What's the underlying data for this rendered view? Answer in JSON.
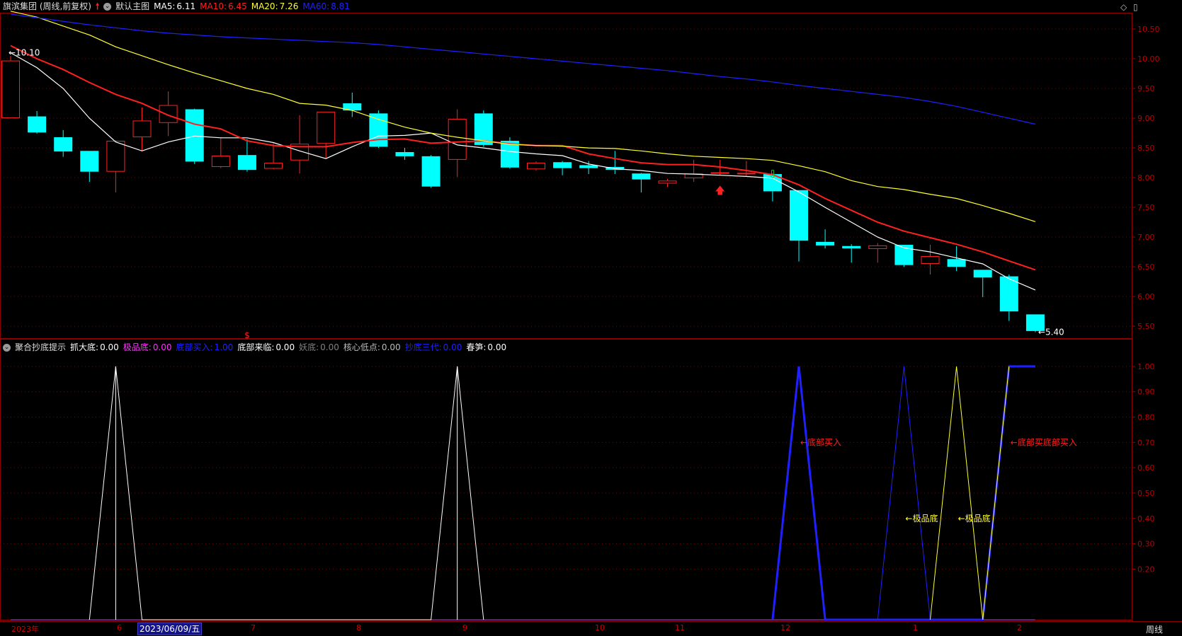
{
  "header_top": {
    "stock": "旗滨集团 (周线,前复权)",
    "theme": "默认主图",
    "ma": [
      {
        "label": "MA5:",
        "value": "6.11",
        "color": "#ffffff"
      },
      {
        "label": "MA10:",
        "value": "6.45",
        "color": "#ff2020"
      },
      {
        "label": "MA20:",
        "value": "7.26",
        "color": "#ffff30"
      },
      {
        "label": "MA60:",
        "value": "8.81",
        "color": "#2020ff"
      }
    ]
  },
  "header_bottom": {
    "indicator": "聚合抄底提示",
    "items": [
      {
        "label": "抓大底:",
        "value": "0.00",
        "color": "#ffffff"
      },
      {
        "label": "极品底:",
        "value": "0.00",
        "color": "#ff30ff"
      },
      {
        "label": "底部买入:",
        "value": "1.00",
        "color": "#2020ff"
      },
      {
        "label": "底部来临:",
        "value": "0.00",
        "color": "#ffffff"
      },
      {
        "label": "妖底:",
        "value": "0.00",
        "color": "#808080"
      },
      {
        "label": "核心低点:",
        "value": "0.00",
        "color": "#bbbbbb"
      },
      {
        "label": "抄底三代:",
        "value": "0.00",
        "color": "#2020ff"
      },
      {
        "label": "春笋:",
        "value": "0.00",
        "color": "#ffffff"
      }
    ]
  },
  "x_axis": {
    "labels": [
      "2023年",
      "6",
      "7",
      "8",
      "9",
      "10",
      "11",
      "12",
      "1",
      "2"
    ],
    "cursor_date": "2023/06/09/五",
    "period": "周线"
  },
  "chart_data": [
    {
      "type": "candlestick",
      "ylim": [
        5.3,
        10.75
      ],
      "y_ticks": [
        "10.50",
        "10.00",
        "9.50",
        "9.00",
        "8.50",
        "8.00",
        "7.50",
        "7.00",
        "6.50",
        "6.00",
        "5.50"
      ],
      "candles": [
        {
          "o": 9.0,
          "c": 9.97,
          "h": 10.05,
          "l": 9.0
        },
        {
          "o": 9.03,
          "c": 8.76,
          "h": 9.12,
          "l": 8.74
        },
        {
          "o": 8.68,
          "c": 8.44,
          "h": 8.8,
          "l": 8.35
        },
        {
          "o": 8.45,
          "c": 8.1,
          "h": 8.45,
          "l": 7.93
        },
        {
          "o": 8.1,
          "c": 8.62,
          "h": 8.63,
          "l": 7.75
        },
        {
          "o": 8.68,
          "c": 8.96,
          "h": 9.18,
          "l": 8.44
        },
        {
          "o": 8.92,
          "c": 9.22,
          "h": 9.45,
          "l": 8.7
        },
        {
          "o": 9.15,
          "c": 8.27,
          "h": 9.16,
          "l": 8.23
        },
        {
          "o": 8.18,
          "c": 8.37,
          "h": 8.67,
          "l": 8.16
        },
        {
          "o": 8.38,
          "c": 8.13,
          "h": 8.65,
          "l": 8.1
        },
        {
          "o": 8.15,
          "c": 8.25,
          "h": 8.58,
          "l": 8.14
        },
        {
          "o": 8.29,
          "c": 8.57,
          "h": 9.05,
          "l": 8.07
        },
        {
          "o": 8.57,
          "c": 9.11,
          "h": 9.11,
          "l": 8.32
        },
        {
          "o": 9.25,
          "c": 9.13,
          "h": 9.43,
          "l": 9.02
        },
        {
          "o": 9.08,
          "c": 8.52,
          "h": 9.13,
          "l": 8.5
        },
        {
          "o": 8.43,
          "c": 8.36,
          "h": 8.5,
          "l": 8.3
        },
        {
          "o": 8.36,
          "c": 7.85,
          "h": 8.38,
          "l": 7.83
        },
        {
          "o": 8.3,
          "c": 8.99,
          "h": 9.15,
          "l": 8.01
        },
        {
          "o": 9.08,
          "c": 8.55,
          "h": 9.13,
          "l": 8.52
        },
        {
          "o": 8.62,
          "c": 8.17,
          "h": 8.68,
          "l": 8.15
        },
        {
          "o": 8.14,
          "c": 8.25,
          "h": 8.27,
          "l": 8.12
        },
        {
          "o": 8.26,
          "c": 8.16,
          "h": 8.28,
          "l": 8.04
        },
        {
          "o": 8.21,
          "c": 8.16,
          "h": 8.28,
          "l": 8.06
        },
        {
          "o": 8.18,
          "c": 8.13,
          "h": 8.45,
          "l": 8.06
        },
        {
          "o": 8.07,
          "c": 7.97,
          "h": 8.08,
          "l": 7.75
        },
        {
          "o": 7.9,
          "c": 7.95,
          "h": 7.98,
          "l": 7.84
        },
        {
          "o": 7.99,
          "c": 8.07,
          "h": 8.3,
          "l": 7.93
        },
        {
          "o": 8.08,
          "c": 8.09,
          "h": 8.3,
          "l": 8.04
        },
        {
          "o": 8.08,
          "c": 8.08,
          "h": 8.28,
          "l": 8.03
        },
        {
          "o": 8.06,
          "c": 7.77,
          "h": 8.07,
          "l": 7.6
        },
        {
          "o": 7.79,
          "c": 6.94,
          "h": 7.79,
          "l": 6.59
        },
        {
          "o": 6.92,
          "c": 6.86,
          "h": 7.13,
          "l": 6.81
        },
        {
          "o": 6.85,
          "c": 6.81,
          "h": 6.88,
          "l": 6.57
        },
        {
          "o": 6.8,
          "c": 6.86,
          "h": 6.9,
          "l": 6.57
        },
        {
          "o": 6.87,
          "c": 6.53,
          "h": 6.87,
          "l": 6.5
        },
        {
          "o": 6.55,
          "c": 6.68,
          "h": 6.87,
          "l": 6.37
        },
        {
          "o": 6.63,
          "c": 6.5,
          "h": 6.85,
          "l": 6.43
        },
        {
          "o": 6.45,
          "c": 6.32,
          "h": 6.45,
          "l": 5.99
        },
        {
          "o": 6.34,
          "c": 5.75,
          "h": 6.37,
          "l": 5.59
        },
        {
          "o": 5.7,
          "c": 5.42,
          "h": 5.7,
          "l": 5.4
        }
      ],
      "series": [
        {
          "name": "MA5",
          "color": "#ffffff",
          "values": [
            10.1,
            9.85,
            9.5,
            9.0,
            8.6,
            8.45,
            8.6,
            8.7,
            8.67,
            8.67,
            8.59,
            8.45,
            8.32,
            8.52,
            8.7,
            8.71,
            8.75,
            8.55,
            8.5,
            8.44,
            8.4,
            8.37,
            8.23,
            8.15,
            8.12,
            8.07,
            8.06,
            8.04,
            8.02,
            7.99,
            7.76,
            7.5,
            7.25,
            7.0,
            6.82,
            6.75,
            6.65,
            6.55,
            6.3,
            6.11
          ]
        },
        {
          "name": "MA10",
          "color": "#ff2020",
          "values": [
            10.22,
            10.0,
            9.82,
            9.6,
            9.4,
            9.25,
            9.05,
            8.9,
            8.82,
            8.62,
            8.54,
            8.52,
            8.52,
            8.59,
            8.64,
            8.65,
            8.58,
            8.6,
            8.62,
            8.57,
            8.54,
            8.54,
            8.4,
            8.32,
            8.25,
            8.22,
            8.22,
            8.18,
            8.12,
            8.05,
            7.88,
            7.65,
            7.45,
            7.25,
            7.1,
            6.99,
            6.88,
            6.75,
            6.6,
            6.45
          ]
        },
        {
          "name": "MA20",
          "color": "#ffff30",
          "values": [
            10.8,
            10.7,
            10.55,
            10.4,
            10.2,
            10.05,
            9.9,
            9.76,
            9.63,
            9.5,
            9.4,
            9.25,
            9.22,
            9.13,
            8.98,
            8.85,
            8.75,
            8.68,
            8.62,
            8.56,
            8.54,
            8.53,
            8.5,
            8.49,
            8.45,
            8.4,
            8.36,
            8.34,
            8.32,
            8.29,
            8.2,
            8.1,
            7.95,
            7.85,
            7.8,
            7.72,
            7.65,
            7.53,
            7.4,
            7.26
          ]
        },
        {
          "name": "MA60",
          "color": "#2020ff",
          "values": [
            10.75,
            10.69,
            10.63,
            10.57,
            10.52,
            10.47,
            10.43,
            10.4,
            10.37,
            10.35,
            10.33,
            10.31,
            10.29,
            10.27,
            10.24,
            10.2,
            10.16,
            10.12,
            10.08,
            10.04,
            10.0,
            9.96,
            9.92,
            9.88,
            9.84,
            9.8,
            9.75,
            9.7,
            9.66,
            9.61,
            9.55,
            9.5,
            9.45,
            9.4,
            9.35,
            9.28,
            9.2,
            9.1,
            9.0,
            8.9
          ]
        }
      ],
      "annotations": [
        {
          "text": "←10.10",
          "index": 0,
          "value": 10.1
        },
        {
          "text": "←5.40",
          "index": 39,
          "value": 5.4
        }
      ],
      "markers": [
        {
          "type": "up-arrow",
          "index": 27,
          "color": "#ff2020"
        },
        {
          "type": "down-arrow",
          "index": 29,
          "color": "#30d030"
        },
        {
          "type": "dollar",
          "index": 9,
          "color": "#ff2020",
          "text": "$"
        }
      ]
    },
    {
      "type": "line",
      "ylim": [
        0,
        1.05
      ],
      "y_ticks": [
        "1.00",
        "0.90",
        "0.80",
        "0.70",
        "0.60",
        "0.50",
        "0.40",
        "0.30",
        "0.20"
      ],
      "series": [
        {
          "name": "抓大底",
          "color": "#ffffff",
          "width": 1,
          "points": [
            [
              3,
              0
            ],
            [
              4,
              1
            ],
            [
              5,
              0
            ],
            [
              16,
              0
            ],
            [
              17,
              1
            ],
            [
              18,
              0
            ]
          ]
        },
        {
          "name": "底部买入",
          "color": "#2020ff",
          "width": 3,
          "points": [
            [
              29,
              0
            ],
            [
              30,
              1
            ],
            [
              31,
              0
            ],
            [
              37,
              0
            ],
            [
              38,
              1
            ],
            [
              39,
              1
            ]
          ]
        },
        {
          "name": "抄底三代",
          "color": "#2020ff",
          "width": 1,
          "points": [
            [
              33,
              0
            ],
            [
              34,
              1
            ],
            [
              35,
              0
            ]
          ]
        },
        {
          "name": "极品底",
          "color": "#ffff30",
          "width": 1,
          "points": [
            [
              35,
              0
            ],
            [
              36,
              1
            ],
            [
              37,
              0
            ]
          ]
        },
        {
          "name": "妖底",
          "color": "#ffff30",
          "width": 1,
          "points": [
            [
              37,
              0
            ],
            [
              38,
              1
            ]
          ]
        }
      ],
      "annotations": [
        {
          "text": "←底部买入",
          "color": "#ff2020",
          "index": 30,
          "value": 0.7
        },
        {
          "text": "←底部买底部买入",
          "color": "#ff2020",
          "index": 38,
          "value": 0.7
        },
        {
          "text": "←极品底",
          "color": "#ffff30",
          "index": 34,
          "value": 0.4
        },
        {
          "text": "←极品底",
          "color": "#ffff30",
          "index": 36,
          "value": 0.4
        }
      ]
    }
  ]
}
